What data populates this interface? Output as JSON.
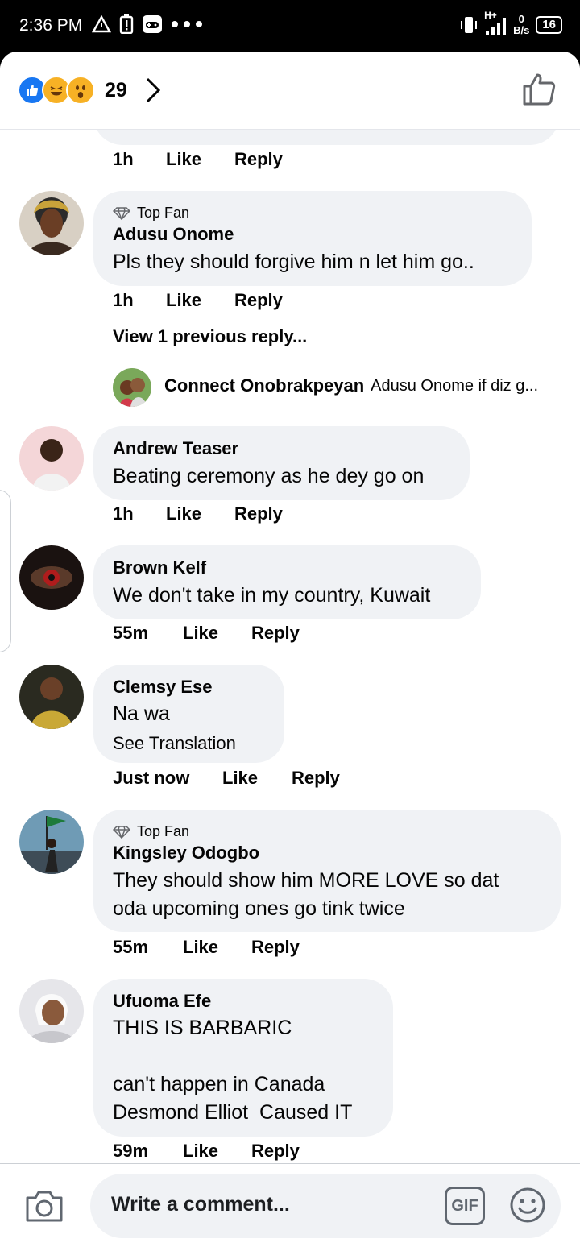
{
  "status_bar": {
    "time": "2:36 PM",
    "network": "H+",
    "speed_top": "0",
    "speed_unit": "B/s",
    "battery": "16"
  },
  "header": {
    "reaction_count": "29"
  },
  "truncated_comment": {
    "time": "1h",
    "like": "Like",
    "reply": "Reply"
  },
  "comments": [
    {
      "badge": "Top Fan",
      "name": "Adusu Onome",
      "text": "Pls they should forgive him n let him go..",
      "time": "1h",
      "like": "Like",
      "reply": "Reply"
    },
    {
      "name": "Andrew Teaser",
      "text": "Beating ceremony as he dey go on",
      "time": "1h",
      "like": "Like",
      "reply": "Reply"
    },
    {
      "name": "Brown Kelf",
      "text": "We don't take in my country, Kuwait",
      "time": "55m",
      "like": "Like",
      "reply": "Reply"
    },
    {
      "name": "Clemsy Ese",
      "text": "Na wa",
      "see_translation": "See Translation",
      "time": "Just now",
      "like": "Like",
      "reply": "Reply"
    },
    {
      "badge": "Top Fan",
      "name": "Kingsley Odogbo",
      "text_line1": "They should show him MORE LOVE so dat",
      "text_line2": "oda upcoming ones go tink twice",
      "time": "55m",
      "like": "Like",
      "reply": "Reply"
    },
    {
      "name": "Ufuoma Efe",
      "text_line1": "THIS IS BARBARIC",
      "text_line2": "can't happen in Canada",
      "text_line3": "Desmond Elliot  Caused IT",
      "time": "59m",
      "like": "Like",
      "reply": "Reply"
    }
  ],
  "thread": {
    "view_previous": "View 1 previous reply...",
    "reply_name": "Connect Onobrakpeyan",
    "reply_preview": "Adusu Onome if diz g..."
  },
  "composer": {
    "placeholder": "Write a comment...",
    "gif_label": "GIF"
  },
  "colors": {
    "bubble": "#f0f2f5",
    "like_blue": "#1877f2",
    "emoji_yellow": "#f7b125",
    "divider": "#e4e6eb"
  }
}
